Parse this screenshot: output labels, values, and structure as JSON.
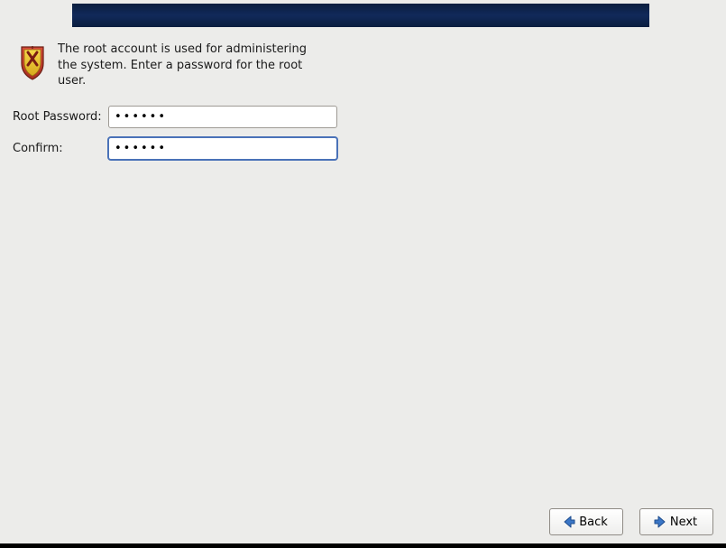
{
  "intro_text": "The root account is used for administering the system.  Enter a password for the root user.",
  "labels": {
    "root_password": "Root Password:",
    "confirm": "Confirm:"
  },
  "inputs": {
    "root_password_value": "••••••",
    "confirm_value": "••••••"
  },
  "buttons": {
    "back": "Back",
    "next": "Next"
  },
  "icons": {
    "shield": "shield-icon",
    "back_arrow": "arrow-left-icon",
    "next_arrow": "arrow-right-icon"
  },
  "colors": {
    "banner": "#11295a",
    "arrow_blue": "#3a76c6"
  }
}
